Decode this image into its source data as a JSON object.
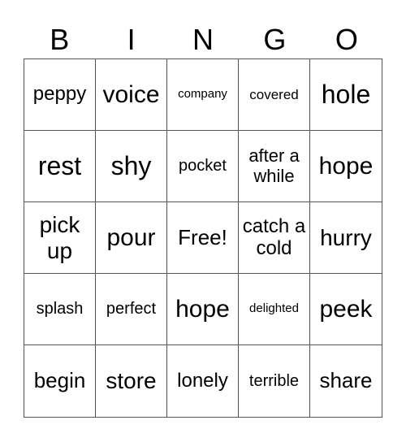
{
  "header": {
    "letters": [
      "B",
      "I",
      "N",
      "G",
      "O"
    ]
  },
  "grid": {
    "rows": [
      [
        "peppy",
        "voice",
        "company",
        "covered",
        "hole"
      ],
      [
        "rest",
        "shy",
        "pocket",
        "after a while",
        "hope"
      ],
      [
        "pick up",
        "pour",
        "Free!",
        "catch a cold",
        "hurry"
      ],
      [
        "splash",
        "perfect",
        "hope",
        "delighted",
        "peek"
      ],
      [
        "begin",
        "store",
        "lonely",
        "terrible",
        "share"
      ]
    ]
  }
}
